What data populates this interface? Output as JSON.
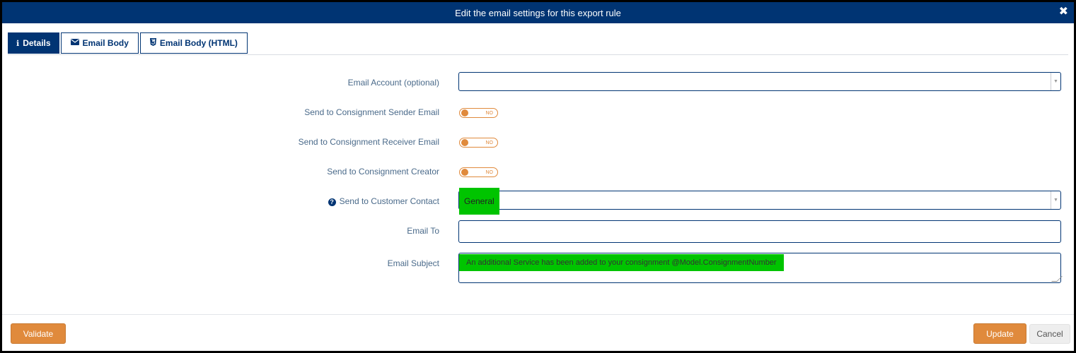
{
  "dialog": {
    "title": "Edit the email settings for this export rule",
    "close_icon": "close-icon"
  },
  "tabs": [
    {
      "label": "Details",
      "icon": "info-icon",
      "active": true
    },
    {
      "label": "Email Body",
      "icon": "envelope-icon",
      "active": false
    },
    {
      "label": "Email Body (HTML)",
      "icon": "html5-icon",
      "active": false
    }
  ],
  "form": {
    "email_account": {
      "label": "Email Account (optional)",
      "value": ""
    },
    "sender_email": {
      "label": "Send to Consignment Sender Email",
      "state": "NO"
    },
    "receiver_email": {
      "label": "Send to Consignment Receiver Email",
      "state": "NO"
    },
    "creator": {
      "label": "Send to Consignment Creator",
      "state": "NO"
    },
    "customer_contact": {
      "label": "Send to Customer Contact",
      "value": "General",
      "help_icon": "question-circle-icon"
    },
    "email_to": {
      "label": "Email To",
      "value": ""
    },
    "email_subject": {
      "label": "Email Subject",
      "value": "An additional Service has been added to your consignment @Model.ConsignmentNumber"
    }
  },
  "footer": {
    "validate_label": "Validate",
    "update_label": "Update",
    "cancel_label": "Cancel"
  },
  "colors": {
    "primary": "#003473",
    "accent": "#e08a3c",
    "highlight": "#00c400"
  }
}
